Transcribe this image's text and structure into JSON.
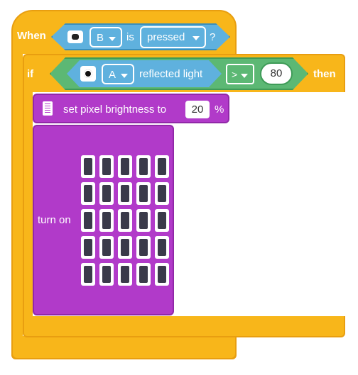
{
  "event": {
    "when_label": "When",
    "port_dropdown": "B",
    "is_label": "is",
    "state_dropdown": "pressed",
    "question_mark": "?"
  },
  "if_block": {
    "if_label": "if",
    "then_label": "then",
    "sensor_port": "A",
    "sensor_reading": "reflected light",
    "operator": ">",
    "compare_value": "80"
  },
  "brightness_block": {
    "label": "set pixel brightness to",
    "value": "20",
    "unit": "%"
  },
  "turn_on_block": {
    "label": "turn on",
    "matrix_rows": 5,
    "matrix_cols": 5,
    "all_pixels_on": true
  },
  "colors": {
    "event_orange": "#f8b61a",
    "sensor_blue": "#5fb1de",
    "operator_green": "#5cb874",
    "light_purple": "#b13ac9"
  }
}
